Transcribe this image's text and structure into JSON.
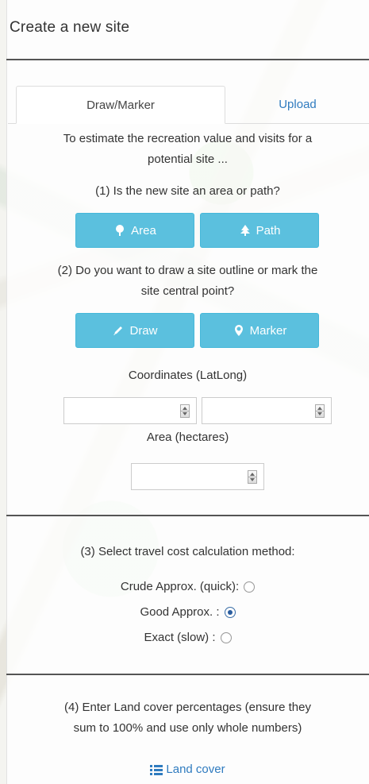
{
  "panel": {
    "title": "Create a new site"
  },
  "tabs": [
    {
      "label": "Draw/Marker",
      "active": true
    },
    {
      "label": "Upload",
      "active": false
    }
  ],
  "intro": {
    "line1": "To estimate the recreation value and visits for a",
    "line2": "potential site ..."
  },
  "step1": {
    "question": "(1) Is the new site an area or path?",
    "area_label": "Area",
    "path_label": "Path"
  },
  "step2": {
    "question_line1": "(2) Do you want to draw a site outline or mark the",
    "question_line2": "site central point?",
    "draw_label": "Draw",
    "marker_label": "Marker",
    "coords_label": "Coordinates (LatLong)",
    "lat_value": "",
    "long_value": "",
    "area_label": "Area (hectares)",
    "area_value": ""
  },
  "step3": {
    "question": "(3) Select travel cost calculation method:",
    "options": [
      {
        "label": "Crude Approx. (quick):",
        "checked": false
      },
      {
        "label": "Good Approx. :",
        "checked": true
      },
      {
        "label": "Exact (slow) :",
        "checked": false
      }
    ]
  },
  "step4": {
    "line1": "(4) Enter Land cover percentages (ensure they",
    "line2": "sum to 100% and use only whole numbers)",
    "link_label": "Land cover"
  },
  "colors": {
    "button_bg": "#5bc0de",
    "link": "#2f7bbf",
    "radio_checked": "#2a5d9f"
  },
  "icons": {
    "area": "tree-icon",
    "path": "tree-conifer-icon",
    "draw": "pencil-icon",
    "marker": "map-marker-icon",
    "landcover": "list-icon"
  }
}
